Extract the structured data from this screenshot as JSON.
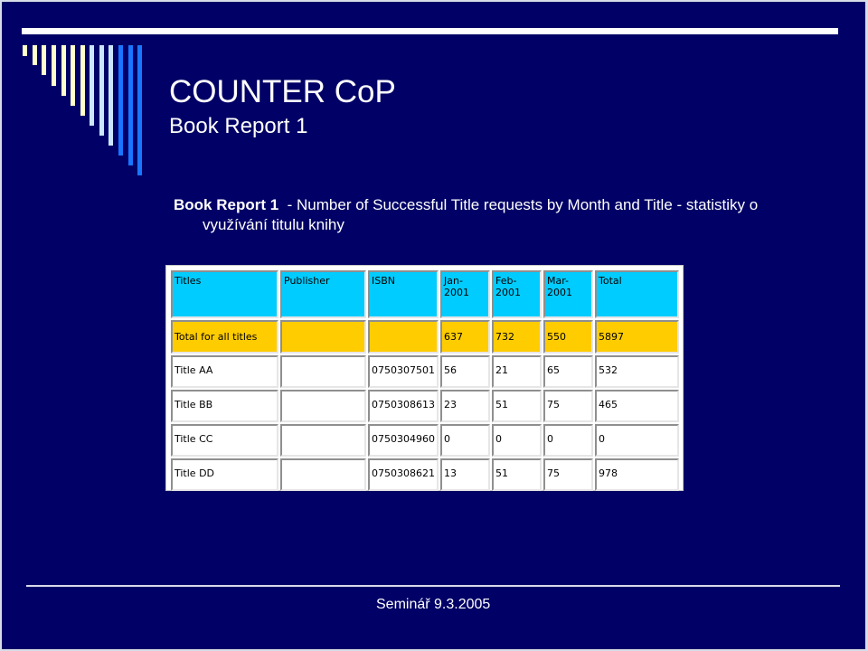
{
  "slide": {
    "title": "COUNTER CoP",
    "subtitle": "Book Report 1",
    "bullet": {
      "lead": "Book Report 1",
      "text": "  - Number of Successful Title requests by Month and Title - statistiky o",
      "continuation": "využívání titulu knihy"
    },
    "footer": "Seminář 9.3.2005",
    "colors": {
      "background": "#000066",
      "header_row": "#00ccff",
      "total_row": "#ffcc00",
      "bar_cream": "#ffffcc",
      "bar_light_blue": "#cce6ff",
      "bar_blue": "#1a75ff"
    }
  },
  "table": {
    "headers": [
      {
        "line1": "Titles",
        "line2": ""
      },
      {
        "line1": "Publisher",
        "line2": ""
      },
      {
        "line1": "ISBN",
        "line2": ""
      },
      {
        "line1": "Jan-",
        "line2": "2001"
      },
      {
        "line1": "Feb-",
        "line2": "2001"
      },
      {
        "line1": "Mar-",
        "line2": "2001"
      },
      {
        "line1": "Total",
        "line2": ""
      }
    ],
    "total_row": [
      "Total for all titles",
      "",
      "",
      "637",
      "732",
      "550",
      "5897"
    ],
    "rows": [
      [
        "Title AA",
        "",
        "0750307501",
        "56",
        "21",
        "65",
        "532"
      ],
      [
        "Title BB",
        "",
        "0750308613",
        "23",
        "51",
        "75",
        "465"
      ],
      [
        "Title CC",
        "",
        "0750304960",
        "0",
        "0",
        "0",
        "0"
      ],
      [
        "Title DD",
        "",
        "0750308621",
        "13",
        "51",
        "75",
        "978"
      ]
    ]
  }
}
